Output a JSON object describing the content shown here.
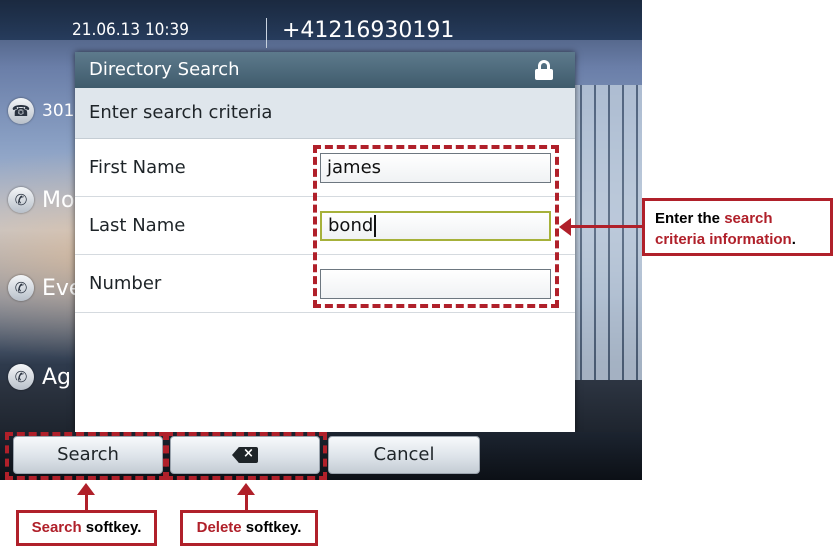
{
  "status_bar": {
    "datetime": "21.06.13 10:39",
    "phone_number": "+41216930191"
  },
  "line_keys": [
    {
      "label": "301",
      "icon": "handset-icon"
    },
    {
      "label": "Mo",
      "icon": "call-forward-icon"
    },
    {
      "label": "Eve",
      "icon": "call-forward-icon"
    },
    {
      "label": "Ag",
      "icon": "call-forward-icon"
    }
  ],
  "dialog": {
    "title": "Directory Search",
    "subtitle": "Enter search criteria",
    "fields": [
      {
        "label": "First Name",
        "value": "james"
      },
      {
        "label": "Last Name",
        "value": "bond"
      },
      {
        "label": "Number",
        "value": ""
      }
    ]
  },
  "softkeys": {
    "search": "Search",
    "delete_icon": "backspace-icon",
    "cancel": "Cancel"
  },
  "annotations": {
    "criteria": {
      "pre": "Enter the ",
      "highlight": "search criteria information",
      "post": "."
    },
    "search_softkey": {
      "highlight": "Search",
      "post": " softkey."
    },
    "delete_softkey": {
      "highlight": "Delete",
      "post": " softkey."
    }
  },
  "colors": {
    "annotation_red": "#b0202a",
    "active_field_border": "#a6b13a",
    "title_bar": "#4a6676"
  }
}
